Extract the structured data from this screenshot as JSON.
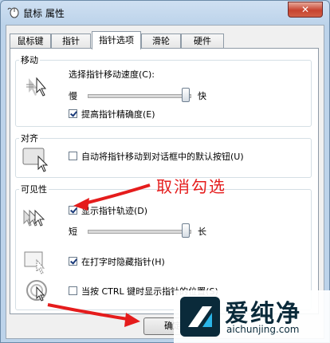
{
  "window": {
    "title": "鼠标 属性",
    "close_label": "✕"
  },
  "tabs": [
    {
      "label": "鼠标键",
      "active": false
    },
    {
      "label": "指针",
      "active": false
    },
    {
      "label": "指针选项",
      "active": true
    },
    {
      "label": "滑轮",
      "active": false
    },
    {
      "label": "硬件",
      "active": false
    }
  ],
  "motion": {
    "group_label": "移动",
    "speed_label": "选择指针移动速度(C):",
    "slow_label": "慢",
    "fast_label": "快",
    "speed_level": 1.0,
    "precision_label": "提高指针精确度(E)",
    "precision_checked": true
  },
  "snap": {
    "group_label": "对齐",
    "snap_label": "自动将指针移动到对话框中的默认按钮(U)",
    "snap_checked": false
  },
  "visibility": {
    "group_label": "可见性",
    "trails_label": "显示指针轨迹(D)",
    "trails_checked": true,
    "short_label": "短",
    "long_label": "长",
    "trails_level": 1.0,
    "hide_label": "在打字时隐藏指针(H)",
    "hide_checked": true,
    "ctrl_label": "当按 CTRL 键时显示指针的位置(S)",
    "ctrl_checked": false
  },
  "buttons": {
    "ok_label": "确定"
  },
  "annotation": {
    "text": "取消勾选",
    "color": "#e51c1c"
  },
  "watermark": {
    "text": "爱纯净",
    "url": "aichunjing.com"
  }
}
